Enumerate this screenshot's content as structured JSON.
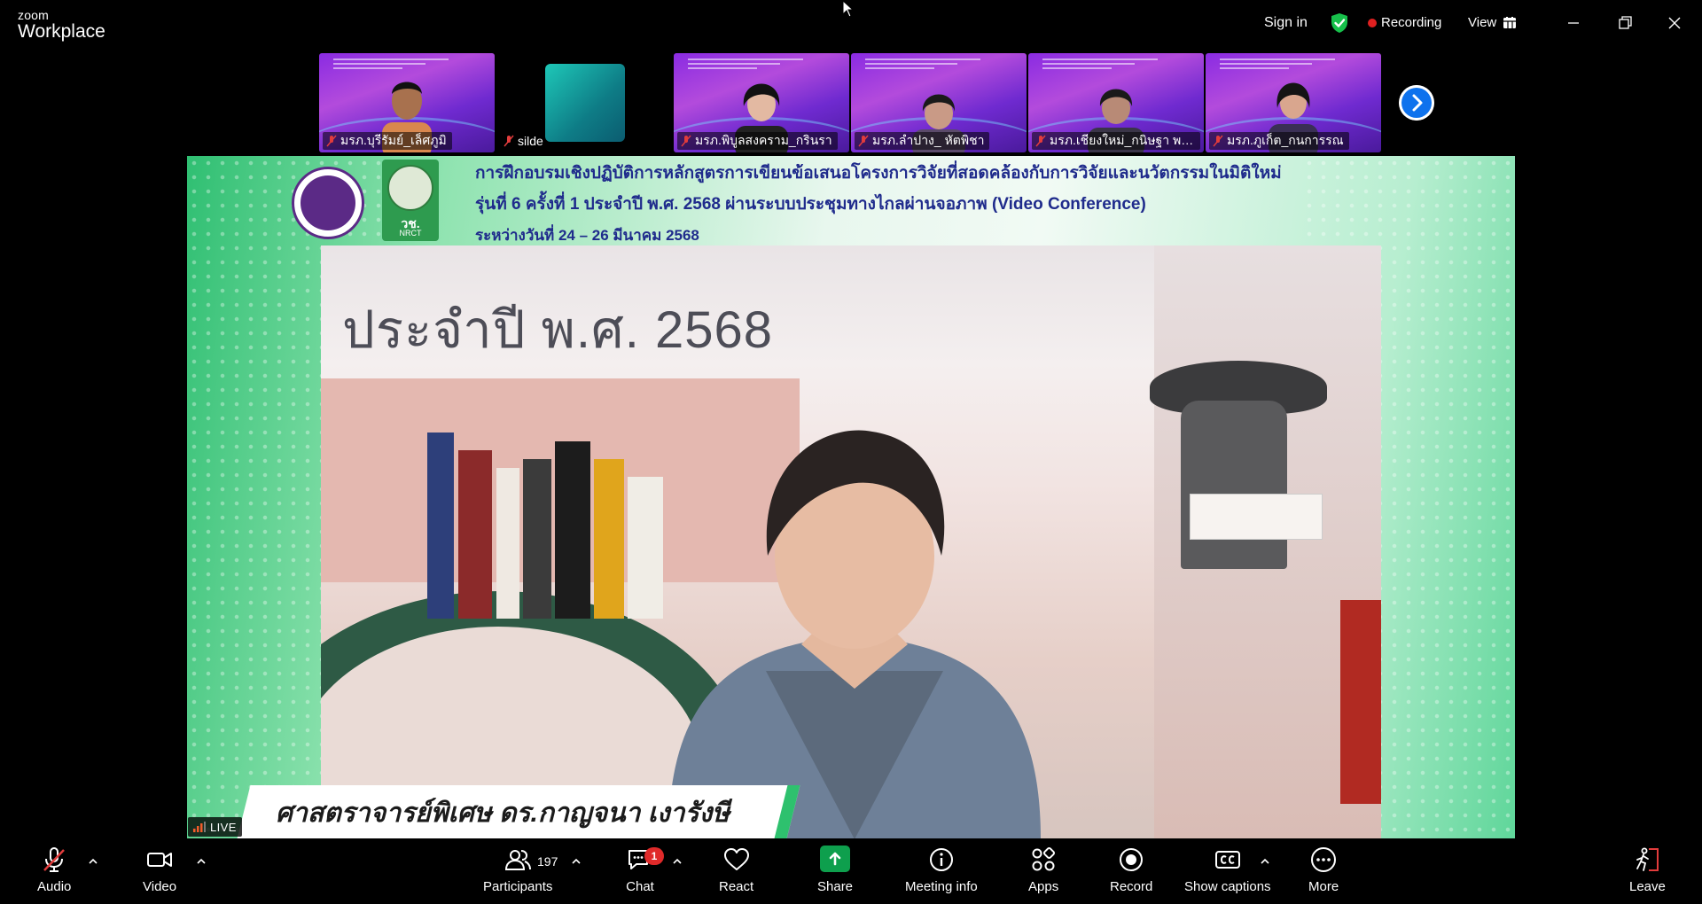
{
  "titlebar": {
    "brand_small": "zoom",
    "brand_big": "Workplace",
    "sign_in": "Sign in",
    "recording": "Recording",
    "view": "View"
  },
  "colors": {
    "recording_dot": "#e02020",
    "shield": "#17c04b",
    "share_green": "#0e9f4d",
    "header_text": "#1f2b8c",
    "thumb_purple": "#8a2be2"
  },
  "thumbnails": [
    {
      "name": "มรภ.บุรีรัมย์_เล็ศภูมิ",
      "type": "person",
      "muted": true
    },
    {
      "name": "silde",
      "type": "screen",
      "muted": true
    },
    {
      "name": "มรภ.พิบูลสงคราม_กรินรา",
      "type": "person",
      "muted": true
    },
    {
      "name": "มรภ.ลำปาง_ หัตพิชา",
      "type": "person",
      "muted": true
    },
    {
      "name": "มรภ.เชียงใหม่_กนิษฐา พวง...",
      "type": "person",
      "muted": true
    },
    {
      "name": "มรภ.ภูเก็ต_กนการรณ",
      "type": "person",
      "muted": true
    }
  ],
  "stage": {
    "header_line1": "การฝึกอบรมเชิงปฏิบัติการหลักสูตรการเขียนข้อเสนอโครงการวิจัยที่สอดคล้องกับการวิจัยและนวัตกรรมในมิติใหม่",
    "header_line2": "รุ่นที่ 6 ครั้งที่ 1 ประจำปี พ.ศ. 2568 ผ่านระบบประชุมทางไกลผ่านจอภาพ (Video Conference)",
    "header_line3": "ระหว่างวันที่ 24 – 26 มีนาคม 2568",
    "logo_nrct_t1": "วช.",
    "logo_nrct_t2": "NRCT",
    "backdrop_year": "ประจำปี พ.ศ. 2568",
    "speaker_caption": "ศาสตราจารย์พิเศษ ดร.กาญจนา เงารังษี",
    "live_label": "LIVE"
  },
  "toolbar": {
    "audio": "Audio",
    "video": "Video",
    "participants": "Participants",
    "participants_count": "197",
    "chat": "Chat",
    "chat_badge": "1",
    "react": "React",
    "share": "Share",
    "meeting_info": "Meeting info",
    "apps": "Apps",
    "record": "Record",
    "show_captions": "Show captions",
    "more": "More",
    "leave": "Leave"
  }
}
